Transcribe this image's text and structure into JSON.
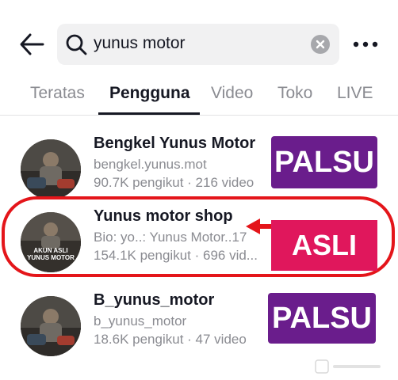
{
  "search": {
    "query": "yunus motor"
  },
  "tabs": [
    {
      "label": "Teratas",
      "active": false
    },
    {
      "label": "Pengguna",
      "active": true
    },
    {
      "label": "Video",
      "active": false
    },
    {
      "label": "Toko",
      "active": false
    },
    {
      "label": "LIVE",
      "active": false
    }
  ],
  "results": [
    {
      "name": "Bengkel Yunus Motor",
      "handle": "bengkel.yunus.mot",
      "stats": "90.7K pengikut · 216 video",
      "label": "PALSU"
    },
    {
      "name": "Yunus motor shop",
      "handle": "Bio: yo..: Yunus Motor..17",
      "stats": "154.1K pengikut · 696 vid...",
      "label": "ASLI",
      "avatar_text": "AKUN ASLI YUNUS MOTOR"
    },
    {
      "name": "B_yunus_motor",
      "handle": "b_yunus_motor",
      "stats": "18.6K pengikut · 47 video",
      "label": "PALSU"
    }
  ],
  "colors": {
    "palsu_badge": "#6a1d8c",
    "asli_badge": "#e0175c",
    "highlight": "#e4151a",
    "text_primary": "#161823",
    "text_secondary": "#8a8b91"
  },
  "icons": {
    "back": "arrow-left-icon",
    "search": "search-icon",
    "clear": "clear-icon",
    "more": "more-horizontal-icon",
    "pointer": "red-arrow-icon"
  }
}
